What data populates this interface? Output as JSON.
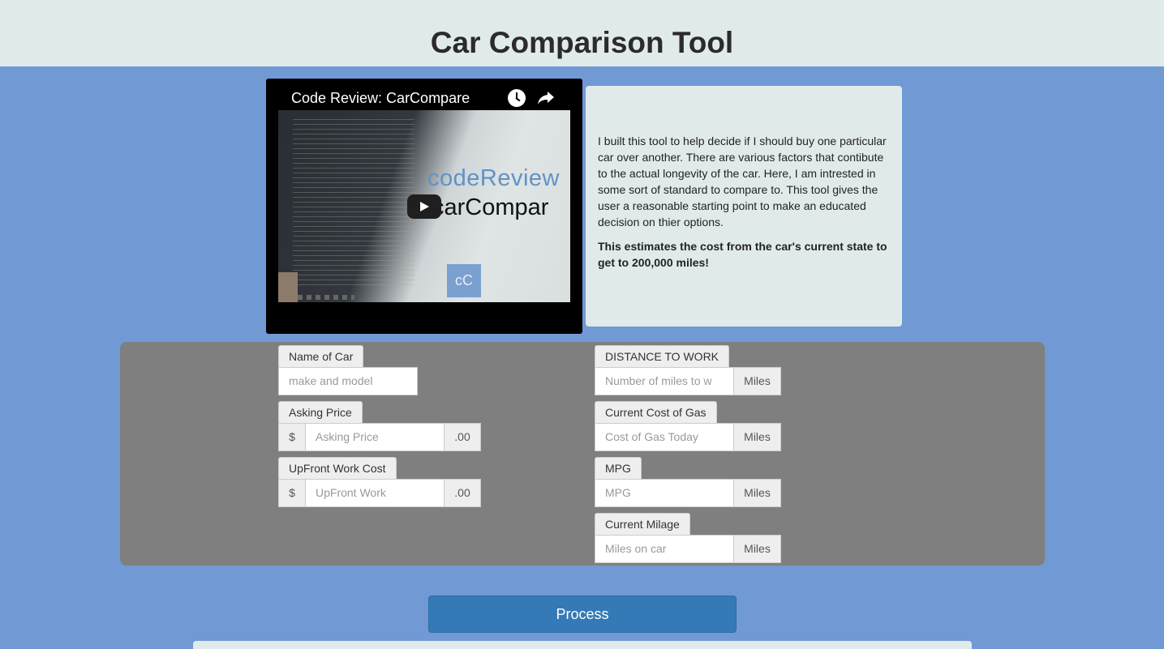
{
  "header": {
    "title": "Car Comparison Tool"
  },
  "video": {
    "title": "Code Review: CarCompare",
    "thumb_line1": "codeReview",
    "thumb_line2": "carCompar",
    "logo_text": "cC"
  },
  "description": {
    "paragraph": "I built this tool to help decide if I should buy one particular car over another. There are various factors that contibute to the actual longevity of the car. Here, I am intrested in some sort of standard to compare to. This tool gives the user a reasonable starting point to make an educated decision on thier options.",
    "emphasis": "This estimates the cost from the car's current state to get to 200,000 miles!"
  },
  "form": {
    "left": {
      "name_of_car": {
        "label": "Name of Car",
        "placeholder": "make and model"
      },
      "asking_price": {
        "label": "Asking Price",
        "prefix": "$",
        "placeholder": "Asking Price",
        "suffix": ".00"
      },
      "upfront_work": {
        "label": "UpFront Work Cost",
        "prefix": "$",
        "placeholder": "UpFront Work",
        "suffix": ".00"
      }
    },
    "right": {
      "distance": {
        "label": "DISTANCE TO WORK",
        "placeholder": "Number of miles to w",
        "suffix": "Miles"
      },
      "gas_cost": {
        "label": "Current Cost of Gas",
        "placeholder": "Cost of Gas Today",
        "suffix": "Miles"
      },
      "mpg": {
        "label": "MPG",
        "placeholder": "MPG",
        "suffix": "Miles"
      },
      "milage": {
        "label": "Current Milage",
        "placeholder": "Miles on car",
        "suffix": "Miles"
      }
    }
  },
  "actions": {
    "process_label": "Process"
  }
}
